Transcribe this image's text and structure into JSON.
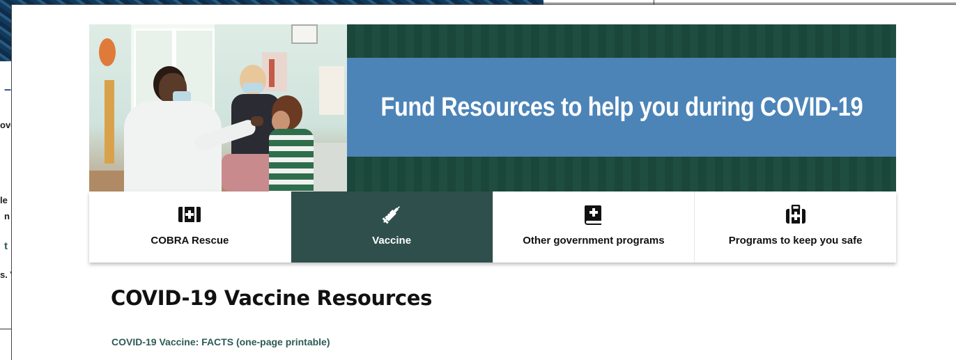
{
  "background_window": {
    "fragments": [
      "–",
      "ove",
      "le",
      "n",
      "t",
      "s. V"
    ]
  },
  "hero": {
    "title": "Fund Resources to help you during COVID-19"
  },
  "tabs": [
    {
      "label": "COBRA Rescue",
      "icon": "medical-kit-icon",
      "active": false
    },
    {
      "label": "Vaccine",
      "icon": "syringe-icon",
      "active": true
    },
    {
      "label": "Other government programs",
      "icon": "medical-book-icon",
      "active": false
    },
    {
      "label": "Programs to keep you safe",
      "icon": "first-aid-briefcase-icon",
      "active": false
    }
  ],
  "content": {
    "heading": "COVID-19 Vaccine Resources",
    "links": [
      "COVID-19 Vaccine: FACTS (one-page printable)"
    ]
  },
  "colors": {
    "hero_green": "#1d4a3d",
    "hero_blue": "#4c84b8",
    "active_tab": "#2f4f4c",
    "link": "#2d5a55"
  }
}
